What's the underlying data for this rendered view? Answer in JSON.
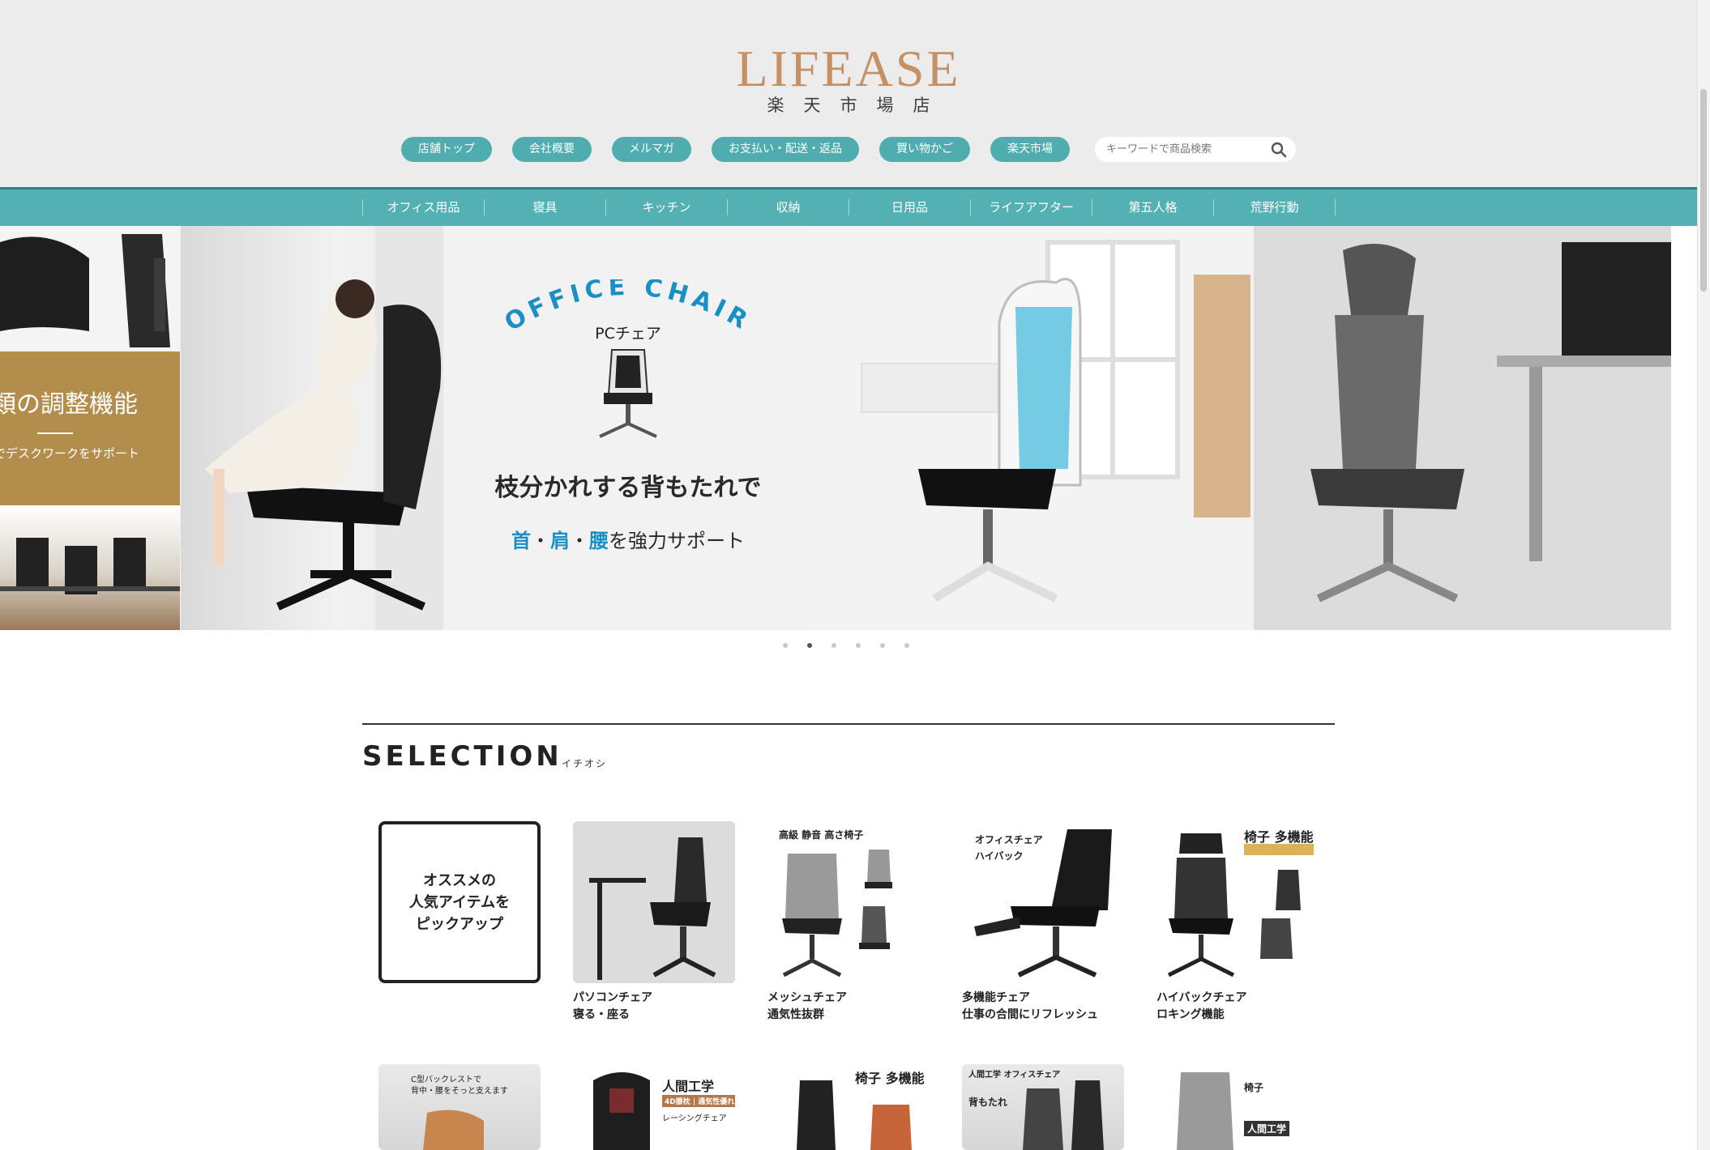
{
  "header": {
    "logo": "LIFEASE",
    "logo_sub": "楽天市場店",
    "links": [
      "店舗トップ",
      "会社概要",
      "メルマガ",
      "お支払い・配送・返品",
      "買い物かご",
      "楽天市場"
    ],
    "search_placeholder": "キーワードで商品検索"
  },
  "categories": [
    "オフィス用品",
    "寝具",
    "キッチン",
    "収納",
    "日用品",
    "ライフアフター",
    "第五人格",
    "荒野行動"
  ],
  "hero": {
    "slide_a_title": "類の調整機能",
    "slide_a_sub": "でデスクワークをサポート",
    "office_chair": "OFFICE CHAIR",
    "pc_chair": "PCチェア",
    "headline": "枝分かれする背もたれで",
    "sub_hl1": "首",
    "sub_dot1": "・",
    "sub_hl2": "肩",
    "sub_dot2": "・",
    "sub_hl3": "腰",
    "sub_rest": "を強力サポート",
    "dots_count": 6,
    "active_dot": 2
  },
  "selection": {
    "title": "SELECTION",
    "subtitle": "イチオシ",
    "intro_text": "オススメの\n人気アイテムを\nピックアップ",
    "items": [
      {
        "line1": "パソコンチェア",
        "line2": "寝る・座る"
      },
      {
        "line1": "メッシュチェア",
        "line2": "通気性抜群",
        "tag": "高級 静音 高さ椅子"
      },
      {
        "line1": "多機能チェア",
        "line2": "仕事の合間にリフレッシュ",
        "tag1": "オフィスチェア",
        "tag2": "ハイバック"
      },
      {
        "line1": "ハイバックチェア",
        "line2": "ロキング機能",
        "tag": "椅子 多機能"
      }
    ],
    "row2_tags": [
      "C型バックレストで",
      "背中・腰をそっと支えます",
      "人間工学",
      "4D腰枕 | 通気性優れ",
      "レーシングチェア",
      "椅子 多機能",
      "人間工学 オフィスチェア",
      "背もたれ",
      "椅子",
      "人間工学"
    ]
  },
  "colors": {
    "accent": "#4fadaf",
    "logo": "#c49064",
    "hero_blue": "#1a8fc4",
    "gold": "#b38d4c"
  }
}
